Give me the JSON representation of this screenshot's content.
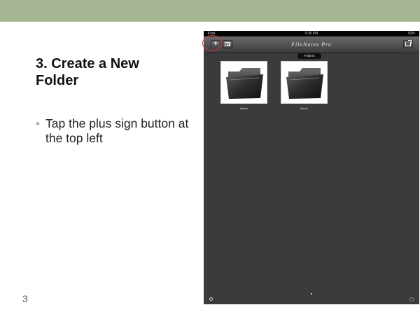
{
  "slide": {
    "title": "3. Create a New Folder",
    "bullets": [
      "Tap the plus sign button at the top left"
    ],
    "number": "3"
  },
  "colors": {
    "accent_bar": "#a5b592",
    "highlight": "#d23a2c",
    "screen_background": "#3a3b3d"
  },
  "ipad": {
    "status_left": "iPad",
    "status_time": "5:35 PM",
    "status_right": "93%",
    "app_title": "FileNotes Pro",
    "nav": {
      "add_icon": "plus-icon",
      "add_glyph": "+",
      "camera_icon": "camera-icon",
      "export_icon": "export-icon"
    },
    "folders_tab": "Folders",
    "folders": [
      {
        "label": "Notes",
        "icon": "folder-icon"
      },
      {
        "label": "Demo",
        "icon": "folder-icon"
      }
    ],
    "bottom_icons": [
      "info-icon",
      "gear-icon"
    ]
  }
}
